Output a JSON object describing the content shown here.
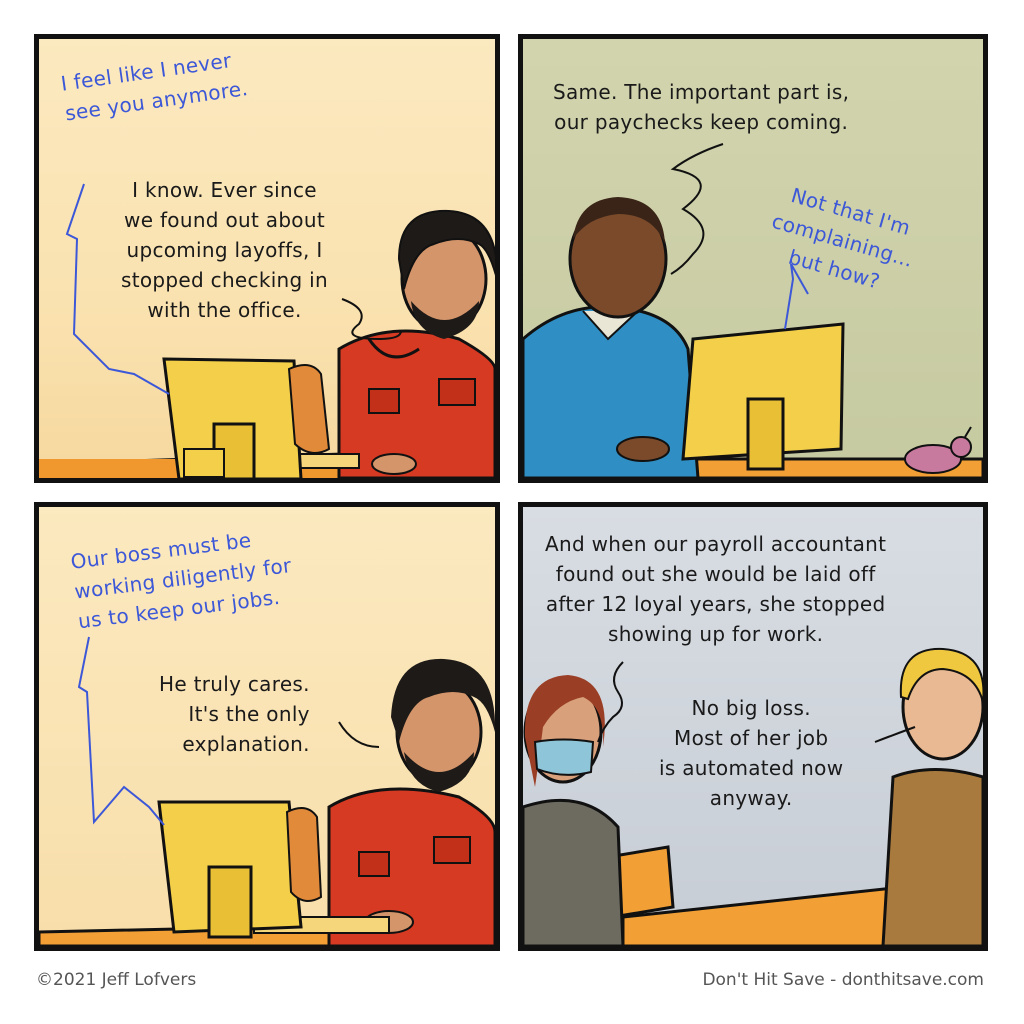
{
  "panels": [
    {
      "speech_offscreen": "I feel like I never\nsee you anymore.",
      "speech_main": "I know. Ever since\nwe found out about\nupcoming layoffs, I\nstopped checking in\nwith the office."
    },
    {
      "speech_main": "Same. The important part is,\nour paychecks keep coming.",
      "speech_offscreen": "Not that I'm\ncomplaining...\nbut how?"
    },
    {
      "speech_offscreen": "Our boss must be\nworking diligently for\nus to keep our jobs.",
      "speech_main": "He truly cares.\nIt's the only\nexplanation."
    },
    {
      "speech_main": "And when our payroll accountant\nfound out she would be laid off\nafter 12 loyal years, she stopped\nshowing up for work.",
      "speech_reply": "No big loss.\nMost of her job\nis automated now\nanyway."
    }
  ],
  "footer": {
    "copyright": "©2021 Jeff Lofvers",
    "site": "Don't Hit Save - donthitsave.com"
  },
  "colors": {
    "offscreen_speech": "#3c58d8",
    "border": "#111111",
    "shirt_red": "#d63a22",
    "polo_blue": "#2f8fc4",
    "monitor_yellow": "#f3cf4a",
    "desk_orange": "#f2a035"
  }
}
